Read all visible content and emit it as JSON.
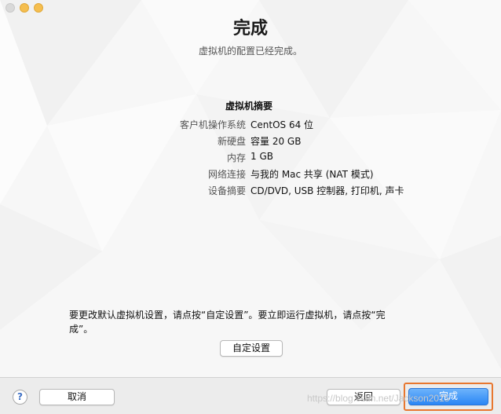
{
  "header": {
    "title": "完成",
    "subtitle": "虚拟机的配置已经完成。"
  },
  "summary": {
    "title": "虚拟机摘要",
    "rows": [
      {
        "label": "客户机操作系统",
        "value": "CentOS 64 位"
      },
      {
        "label": "新硬盘",
        "value": "容量 20 GB"
      },
      {
        "label": "内存",
        "value": "1 GB"
      },
      {
        "label": "网络连接",
        "value": "与我的 Mac 共享 (NAT 模式)"
      },
      {
        "label": "设备摘要",
        "value": "CD/DVD, USB 控制器, 打印机, 声卡"
      }
    ]
  },
  "instruction": {
    "text": "要更改默认虚拟机设置，请点按“自定设置”。要立即运行虚拟机，请点按“完成”。"
  },
  "buttons": {
    "customize": "自定设置",
    "help": "?",
    "cancel": "取消",
    "back": "返回",
    "finish": "完成"
  },
  "watermark": "https://blog.csdn.net/Jackson2015",
  "colors": {
    "accent": "#2a86f5",
    "focus": "#e8772f"
  }
}
